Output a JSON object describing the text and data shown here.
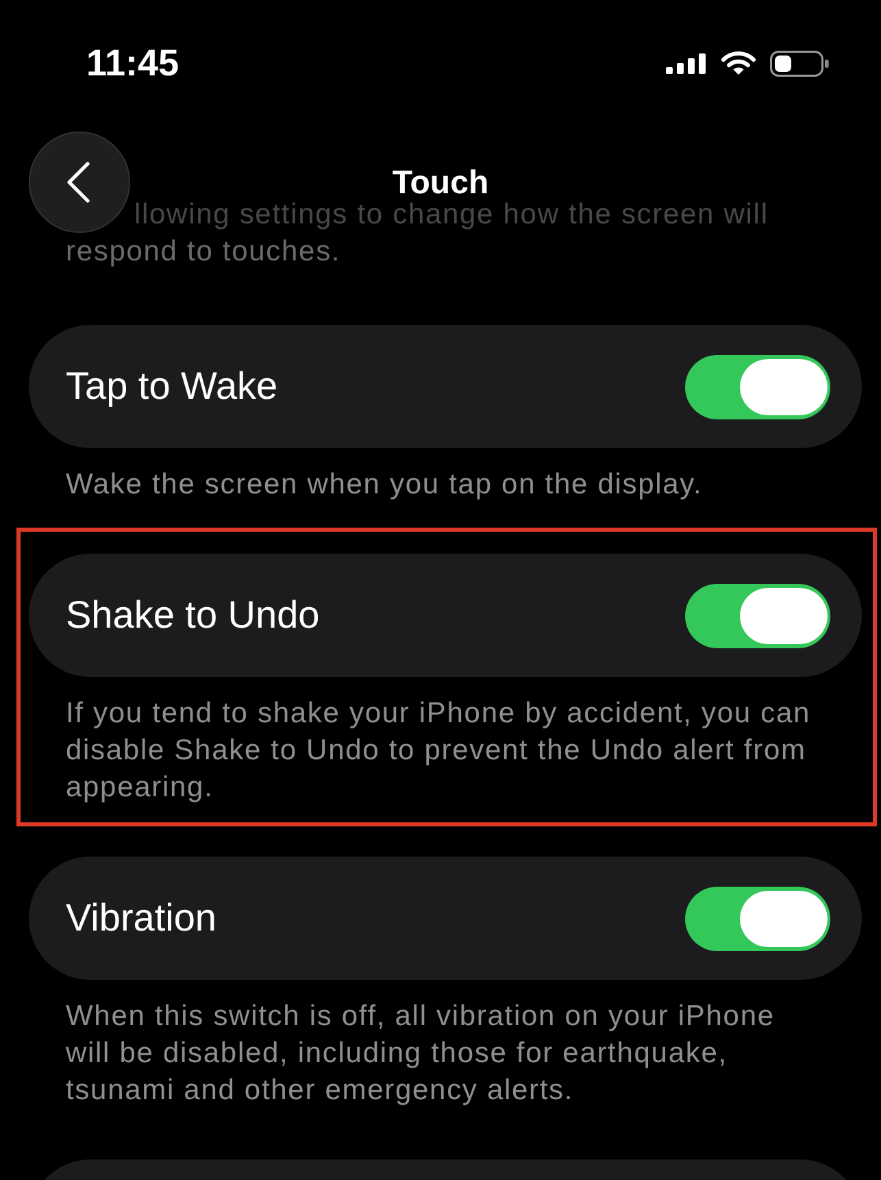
{
  "status_bar": {
    "time": "11:45"
  },
  "nav": {
    "title": "Touch"
  },
  "scrolled_description_lines": [
    "llowing settings to change how the screen will",
    "respond to touches."
  ],
  "settings": [
    {
      "kind": "toggle",
      "label": "Tap to Wake",
      "on": true,
      "highlighted": false,
      "footer": "Wake the screen when you tap on the display."
    },
    {
      "kind": "toggle",
      "label": "Shake to Undo",
      "on": true,
      "highlighted": true,
      "footer": "If you tend to shake your iPhone by accident, you can disable Shake to Undo to prevent the Undo alert from appearing."
    },
    {
      "kind": "toggle",
      "label": "Vibration",
      "on": true,
      "highlighted": false,
      "footer": "When this switch is off, all vibration on your iPhone will be disabled, including those for earthquake, tsunami and other emergency alerts."
    },
    {
      "kind": "cut_off"
    }
  ]
}
